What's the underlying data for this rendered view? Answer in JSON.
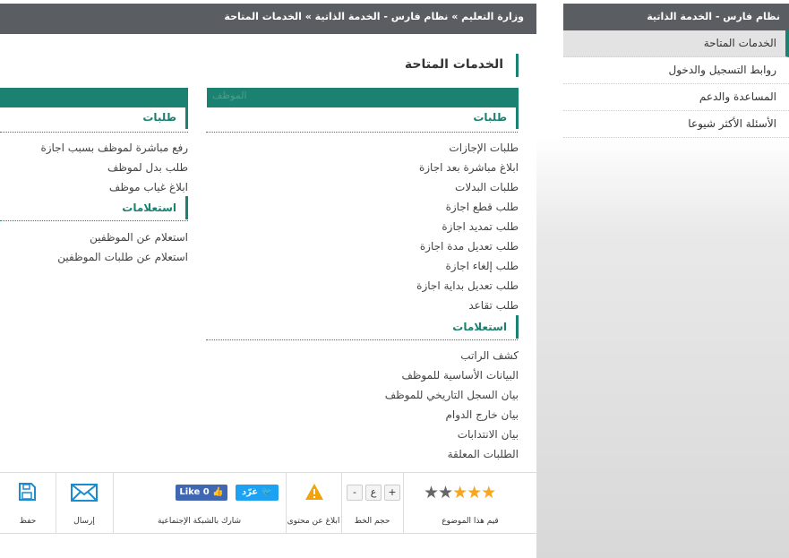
{
  "sidebar": {
    "title": "نظام فارس - الخدمة الذاتية",
    "items": [
      {
        "label": "الخدمات المتاحة"
      },
      {
        "label": "روابط التسجيل والدخول"
      },
      {
        "label": "المساعدة والدعم"
      },
      {
        "label": "الأسئلة الأكثر شيوعا"
      }
    ]
  },
  "breadcrumb": "وزارة التعليم » نظام فارس - الخدمة الذاتية » الخدمات المتاحة",
  "page_title": "الخدمات المتاحة",
  "col_right": {
    "bar_text": "الموظف",
    "requests_title": "طلبات",
    "requests": [
      "طلبات الإجازات",
      "ابلاغ مباشرة بعد اجازة",
      "طلبات البدلات",
      "طلب قطع اجازة",
      "طلب تمديد اجازة",
      "طلب تعديل مدة اجازة",
      "طلب إلغاء اجازة",
      "طلب تعديل بداية اجازة",
      "طلب تقاعد"
    ],
    "inquiries_title": "استعلامات",
    "inquiries": [
      "كشف الراتب",
      "البيانات الأساسية للموظف",
      "بيان السجل التاريخي للموظف",
      "بيان خارج الدوام",
      "بيان الانتدابات",
      "الطلبات المعلقة"
    ]
  },
  "col_left": {
    "requests_title": "طلبات",
    "requests": [
      "رفع مباشرة لموظف بسبب اجازة",
      "طلب بدل لموظف",
      "ابلاغ غياب موظف"
    ],
    "inquiries_title": "استعلامات",
    "inquiries": [
      "استعلام عن الموظفين",
      "استعلام عن طلبات الموظفين"
    ]
  },
  "toolbar": {
    "rate_label": "قيم هذا الموضوع",
    "rating": 3,
    "rating_max": 5,
    "font_label": "حجم الخط",
    "font_plus": "+",
    "font_letter": "ع",
    "font_minus": "-",
    "report_label": "ابلاغ عن محتوى",
    "share_label": "شارك بالشبكة الإجتماعية",
    "tweet_label": "غرّد",
    "like_label": "Like 0",
    "send_label": "إرسال",
    "save_label": "حفظ"
  },
  "colors": {
    "accent": "#1b8170",
    "header": "#5a5d61"
  }
}
